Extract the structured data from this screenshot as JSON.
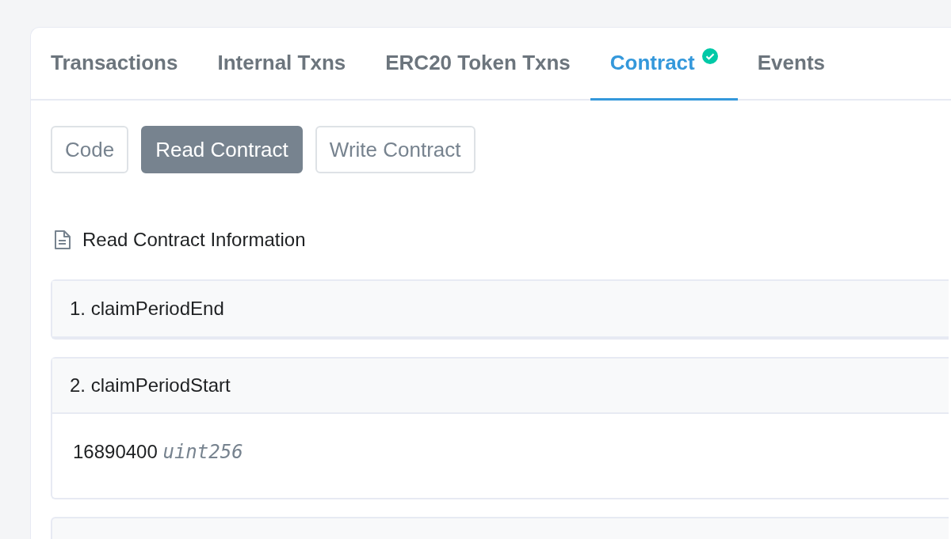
{
  "tabs": [
    {
      "label": "Transactions",
      "selected": false,
      "verified": false
    },
    {
      "label": "Internal Txns",
      "selected": false,
      "verified": false
    },
    {
      "label": "ERC20 Token Txns",
      "selected": false,
      "verified": false
    },
    {
      "label": "Contract",
      "selected": true,
      "verified": true
    },
    {
      "label": "Events",
      "selected": false,
      "verified": false
    }
  ],
  "sub_tabs": [
    {
      "label": "Code",
      "selected": false
    },
    {
      "label": "Read Contract",
      "selected": true
    },
    {
      "label": "Write Contract",
      "selected": false
    }
  ],
  "section_title": "Read Contract Information",
  "functions": [
    {
      "label": "1. claimPeriodEnd",
      "expanded": false
    },
    {
      "label": "2. claimPeriodStart",
      "expanded": true,
      "value": "16890400",
      "type": "uint256"
    }
  ]
}
